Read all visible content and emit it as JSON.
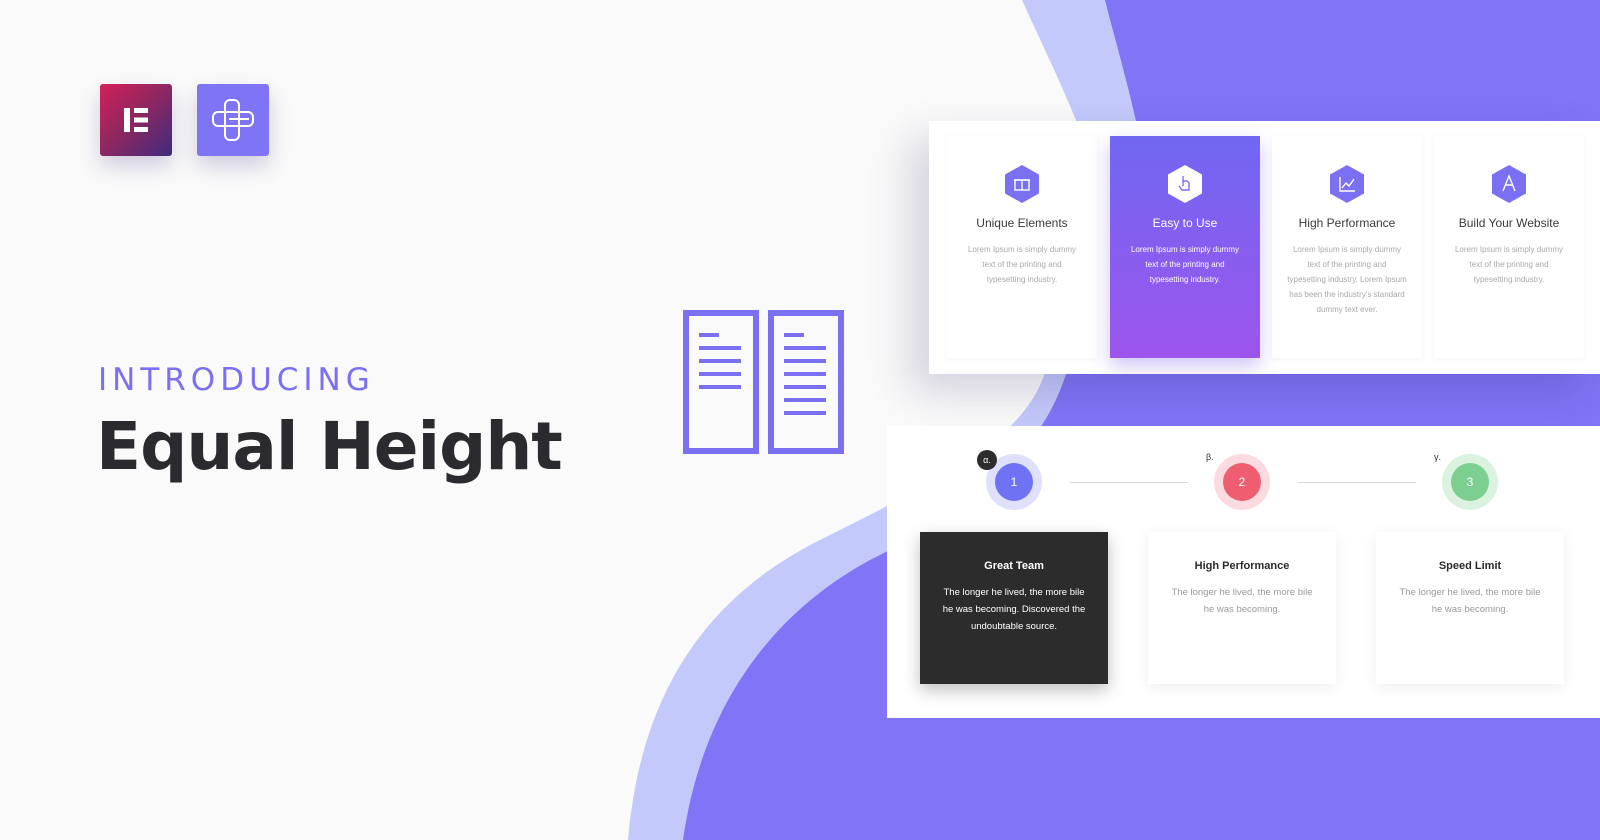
{
  "hero": {
    "intro": "INTRODUCING",
    "title": "Equal Height"
  },
  "logos": {
    "primary": "elementor-logo",
    "secondary": "addon-logo"
  },
  "colors": {
    "accent": "#7b6ff2",
    "blob": "#8174f6",
    "blob_light": "#c3c9fb",
    "title": "#2a2a2f",
    "step1": "#6f72f2",
    "step2": "#ee5d70",
    "step3": "#7ccf8e"
  },
  "features": [
    {
      "name": "Unique Elements",
      "icon": "gift-icon",
      "desc": "Lorem Ipsum is simply dummy text of the printing and typesetting industry."
    },
    {
      "name": "Easy to Use",
      "icon": "hand-pointer-icon",
      "desc": "Lorem Ipsum is simply dummy text of the printing and typesetting industry."
    },
    {
      "name": "High Performance",
      "icon": "chart-icon",
      "desc": "Lorem Ipsum is simply dummy text of the printing and typesetting industry. Lorem Ipsum has been the industry's standard dummy text ever."
    },
    {
      "name": "Build Your Website",
      "icon": "letter-a-icon",
      "desc": "Lorem Ipsum is simply dummy text of the printing and typesetting industry."
    }
  ],
  "steps": [
    {
      "number": "1",
      "greek": "α."
    },
    {
      "number": "2",
      "greek": "β."
    },
    {
      "number": "3",
      "greek": "γ."
    }
  ],
  "cards": [
    {
      "title": "Great Team",
      "desc": "The longer he lived, the more bile he was becoming. Discovered the undoubtable source."
    },
    {
      "title": "High Performance",
      "desc": "The longer he lived, the more bile he was becoming."
    },
    {
      "title": "Speed Limit",
      "desc": "The longer he lived, the more bile he was becoming."
    }
  ]
}
